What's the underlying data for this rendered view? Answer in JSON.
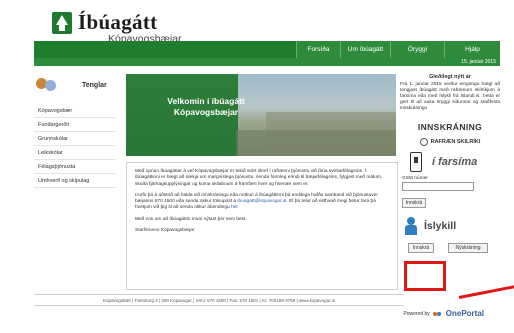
{
  "header": {
    "logo_title": "Íbúagátt",
    "logo_subtitle": "Kópavogsbæjar"
  },
  "nav": {
    "tabs": [
      "Forsíða",
      "Um íbúagátt",
      "Öryggi",
      "Hjálp"
    ],
    "date": "15. janúar 2015"
  },
  "sidebar": {
    "title": "Tenglar",
    "items": [
      "Kópavogsbær",
      "Fundargerðir",
      "Grunnskólar",
      "Leikskólar",
      "Félagsþjónusta",
      "Umhverfi og skipulag"
    ]
  },
  "banner": {
    "line1": "Velkomin í íbúagátt",
    "line2": "Kópavogsbæjar"
  },
  "content": {
    "p1": "Með opnun íbúagáttar á vef Kópavogsbæjar er tekið stórt skref í rafrænni þjónustu við íbúa sveitarfélagsins. Í íbúagáttinni er hægt að sækja um margvíslega þjónustu, senda formleg erindi til bæjarfélagsins, fylgjast með málum, skoða fjárhagsupplýsingar og koma skilaboum á framfæri hver og hvenær sem er.",
    "p2_prefix": "Þurfir þú á aðstoð að halda við innskráningu eða notkun á íbúagáttinni þá endilega hafðu samband við þjónustuver bæjarins 570 1500 eða sendu okkur tölvupóst á",
    "p2_link1": "ibuagatt@kopavogur.is",
    "p2_mid": ". Ef þú telur að eitthvað megi betur fara þá hvetjum við þig til að senda okkur ábendingu",
    "p2_link2": "hér",
    "p3": "Með von um að íbúagáttin muni nýtast þér sem best.",
    "p4": "Starfsmenn Kópavogsbæjar"
  },
  "greeting": {
    "title": "Gleðilegt nýtt ár",
    "text": "Frá 1. janúar 2015 verður eingöngu hægt að tengjast íbúagátt með rafrænum skilríkjum á farsíma eða með Íslykli frá Íslandi.is. Þetta er gert til að auka öryggi siðunnar og staðfesta innskráningu"
  },
  "login": {
    "title": "INNSKRÁNING",
    "rafraen": "RAFRÆN SKILRÍKI",
    "ifarsima": "í farsíma",
    "gsm_label": "GSM númer",
    "innskra_small": "Innskrá",
    "islykill": "Íslykill",
    "innskra": "Innskrá",
    "nyskraning": "Nýskráning"
  },
  "footer": {
    "text": "Kópavogsbær | Fannborg 2 | 200 Kópavogur | Sími: 570 1500 | Fax: 570 1501 | Kt. 700169-3759 | www.kopavogur.is",
    "powered_by": "Powered by",
    "powered_name": "OnePortal"
  },
  "colors": {
    "brand_green": "#1e7e2c",
    "annotation_red": "#e01818",
    "link_blue": "#2a5db0"
  }
}
